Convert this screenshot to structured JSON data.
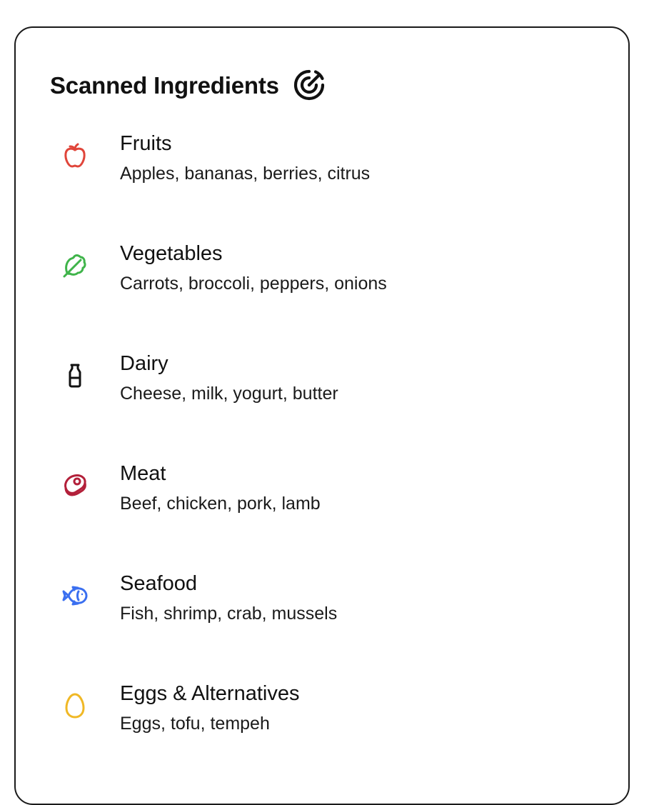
{
  "header": {
    "title": "Scanned Ingredients",
    "icon": "radar-icon"
  },
  "categories": [
    {
      "name": "Fruits",
      "items": "Apples, bananas, berries, citrus",
      "icon": "apple-icon",
      "color": "#e0453a"
    },
    {
      "name": "Vegetables",
      "items": "Carrots, broccoli, peppers, onions",
      "icon": "leaf-icon",
      "color": "#3fb44a"
    },
    {
      "name": "Dairy",
      "items": "Cheese, milk, yogurt, butter",
      "icon": "milk-bottle-icon",
      "color": "#111111"
    },
    {
      "name": "Meat",
      "items": "Beef, chicken, pork, lamb",
      "icon": "steak-icon",
      "color": "#b3203a"
    },
    {
      "name": "Seafood",
      "items": "Fish, shrimp, crab, mussels",
      "icon": "fish-icon",
      "color": "#3a6ff0"
    },
    {
      "name": "Eggs & Alternatives",
      "items": "Eggs, tofu, tempeh",
      "icon": "egg-icon",
      "color": "#f0b825"
    }
  ]
}
